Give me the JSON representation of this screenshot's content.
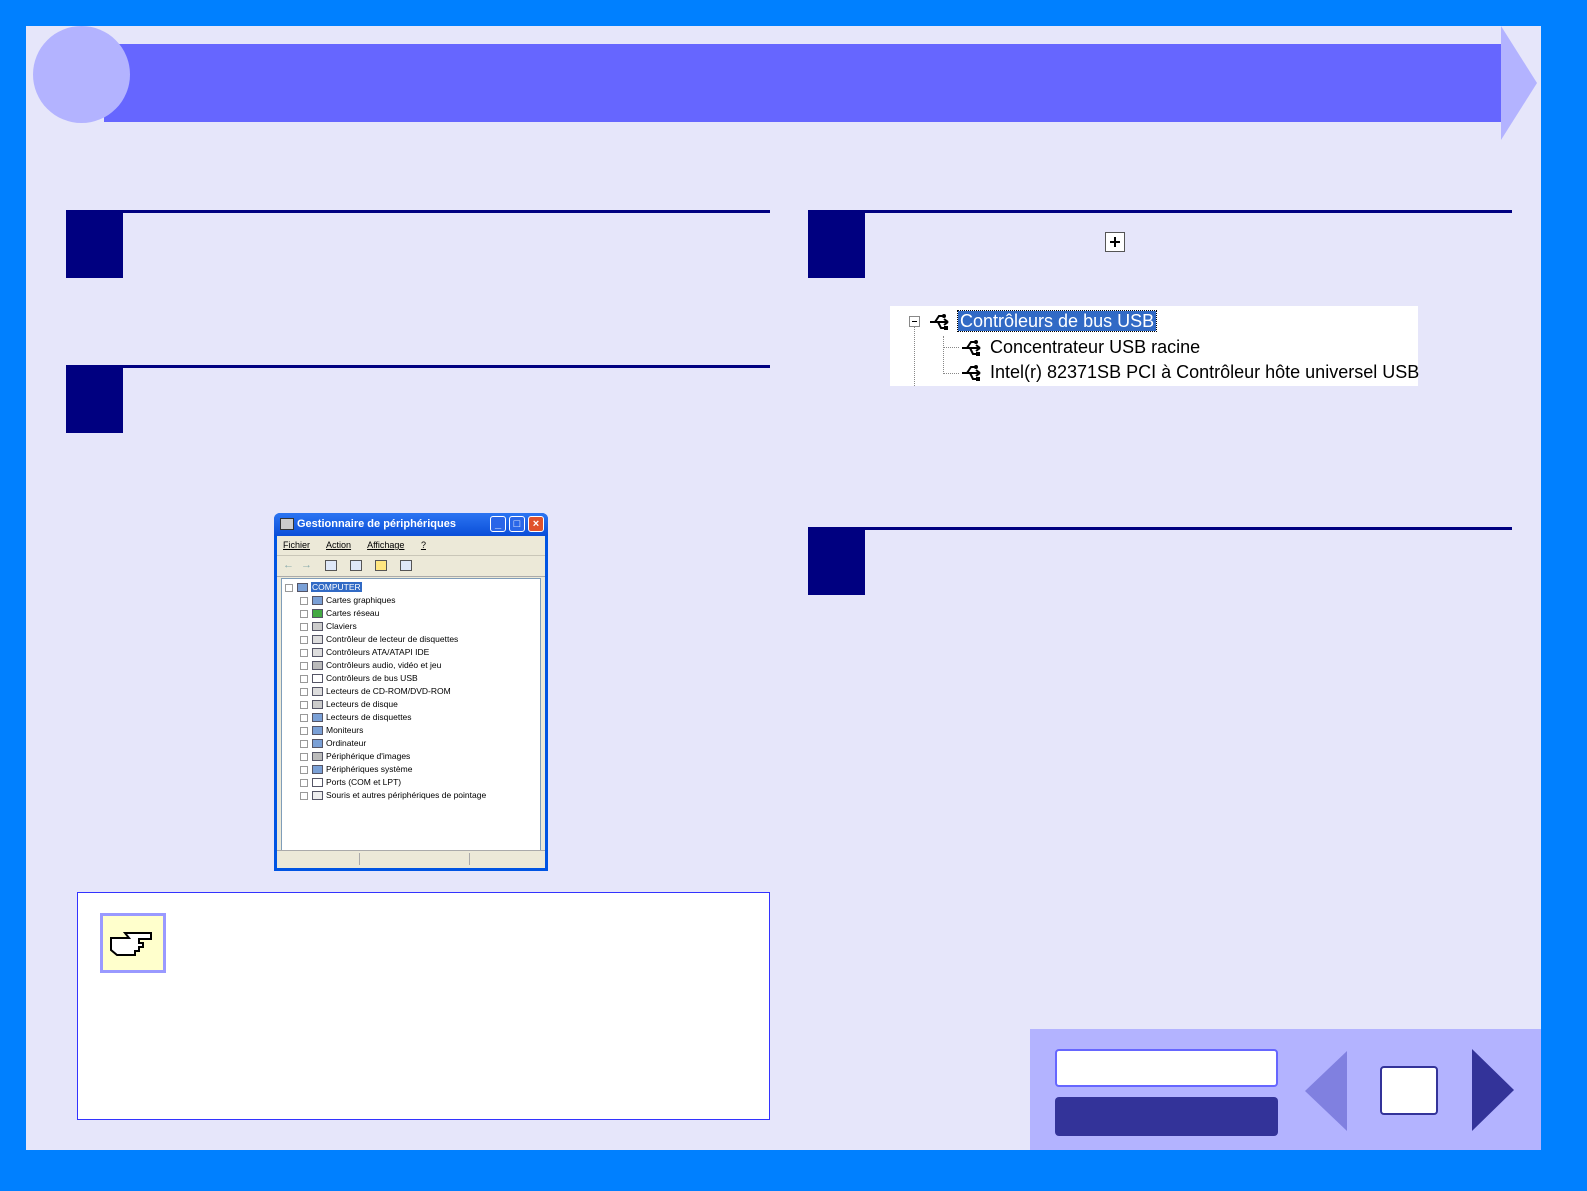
{
  "usb_snippet": {
    "items": [
      {
        "label": "Contrôleurs de bus USB"
      },
      {
        "label": "Concentrateur USB racine"
      },
      {
        "label": "Intel(r) 82371SB PCI à Contrôleur hôte universel USB"
      }
    ]
  },
  "device_manager": {
    "title": "Gestionnaire de périphériques",
    "menu": [
      "Fichier",
      "Action",
      "Affichage",
      "?"
    ],
    "root": "COMPUTER",
    "items": [
      "Cartes graphiques",
      "Cartes réseau",
      "Claviers",
      "Contrôleur de lecteur de disquettes",
      "Contrôleurs ATA/ATAPI IDE",
      "Contrôleurs audio, vidéo et jeu",
      "Contrôleurs de bus USB",
      "Lecteurs de CD-ROM/DVD-ROM",
      "Lecteurs de disque",
      "Lecteurs de disquettes",
      "Moniteurs",
      "Ordinateur",
      "Périphérique d'images",
      "Périphériques système",
      "Ports (COM et LPT)",
      "Souris et autres périphériques de pointage"
    ]
  },
  "nav": {
    "page_number": ""
  },
  "colors": {
    "frame": "#0080ff",
    "page_bg": "#e6e6fa",
    "title_bar": "#6666ff",
    "accent_dark": "#000080",
    "nav_panel": "#b3b3ff"
  }
}
